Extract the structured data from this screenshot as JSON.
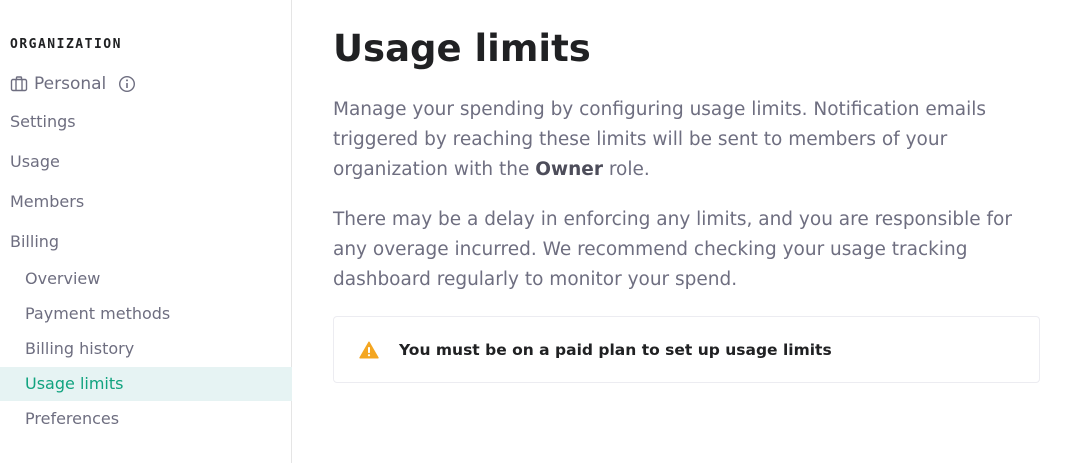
{
  "sidebar": {
    "section_title": "ORGANIZATION",
    "org_name": "Personal",
    "nav": {
      "settings": "Settings",
      "usage": "Usage",
      "members": "Members",
      "billing": "Billing"
    },
    "billing_items": {
      "overview": "Overview",
      "payment_methods": "Payment methods",
      "billing_history": "Billing history",
      "usage_limits": "Usage limits",
      "preferences": "Preferences"
    },
    "active_item": "Usage limits",
    "accent_color": "#10a37f",
    "active_bg_color": "#e6f3f3"
  },
  "main": {
    "title": "Usage limits",
    "para1": {
      "before": "Manage your spending by configuring usage limits. Notification emails triggered by reaching these limits will be sent to members of your organization with the ",
      "bold": "Owner",
      "after": " role."
    },
    "para2": "There may be a delay in enforcing any limits, and you are responsible for any overage incurred. We recommend checking your usage tracking dashboard regularly to monitor your spend.",
    "notice": {
      "icon": "warning-icon",
      "text": "You must be on a paid plan to set up usage limits",
      "icon_color": "#f4a621"
    }
  },
  "icons": {
    "org": "briefcase-icon",
    "info": "info-icon"
  }
}
